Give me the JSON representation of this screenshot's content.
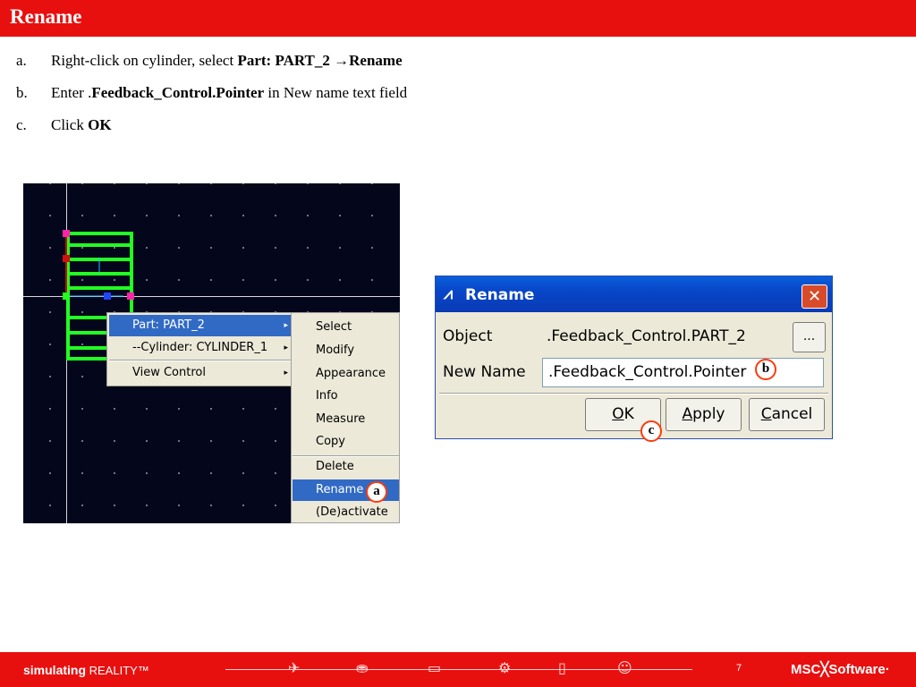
{
  "slide": {
    "title": "Rename",
    "page_number": "7"
  },
  "steps": [
    {
      "label": "a.",
      "prefix": "Right-click on cylinder, select ",
      "bold1": "Part: PART_2 ",
      "arrow": "→",
      "bold2": "Rename"
    },
    {
      "label": "b.",
      "prefix": "Enter .",
      "bold1": "Feedback_Control.Pointer",
      "suffix": " in New name text field"
    },
    {
      "label": "c.",
      "prefix": "Click ",
      "bold1": "OK"
    }
  ],
  "context_menu": {
    "items": [
      {
        "label": "Part: PART_2",
        "selected": true,
        "has_submenu": true
      },
      {
        "label": "--Cylinder: CYLINDER_1",
        "selected": false,
        "has_submenu": true
      },
      {
        "label": "View Control",
        "selected": false,
        "has_submenu": true
      }
    ],
    "submenu_arrow": "▸"
  },
  "submenu": {
    "items": [
      "Select",
      "Modify",
      "Appearance",
      "Info",
      "Measure",
      "Copy",
      "Delete",
      "Rename",
      "(De)activate"
    ],
    "selected": "Rename"
  },
  "callouts": {
    "a": "a",
    "b": "b",
    "c": "c"
  },
  "dialog": {
    "title": "Rename",
    "title_icon": "⩘",
    "close_glyph": "✕",
    "object_label": "Object",
    "object_value": ".Feedback_Control.PART_2",
    "browse_label": "...",
    "new_name_label": "New Name",
    "new_name_value": ".Feedback_Control.Pointer",
    "ok_mnemonic": "O",
    "ok_rest": "K",
    "apply_mnemonic": "A",
    "apply_rest": "pply",
    "cancel_mnemonic": "C",
    "cancel_rest": "ancel"
  },
  "footer": {
    "brand_bold": "simulating",
    "brand_rest": " REALITY™",
    "logo": "MSC╳Software·",
    "timeline_icons": [
      "plane-icon",
      "car-icon",
      "train-icon",
      "gear-icon",
      "phone-icon",
      "person-icon"
    ],
    "timeline_glyphs": [
      "✈",
      "⛂",
      "▭",
      "⚙",
      "▯",
      "☺"
    ]
  },
  "colors": {
    "brand_red": "#e8100f",
    "menu_highlight": "#316ac5",
    "viewport_bg": "#04061c",
    "model_green": "#22ff22",
    "callout_ring": "#ff3a0a",
    "xp_titlebar": "#0846c8"
  }
}
